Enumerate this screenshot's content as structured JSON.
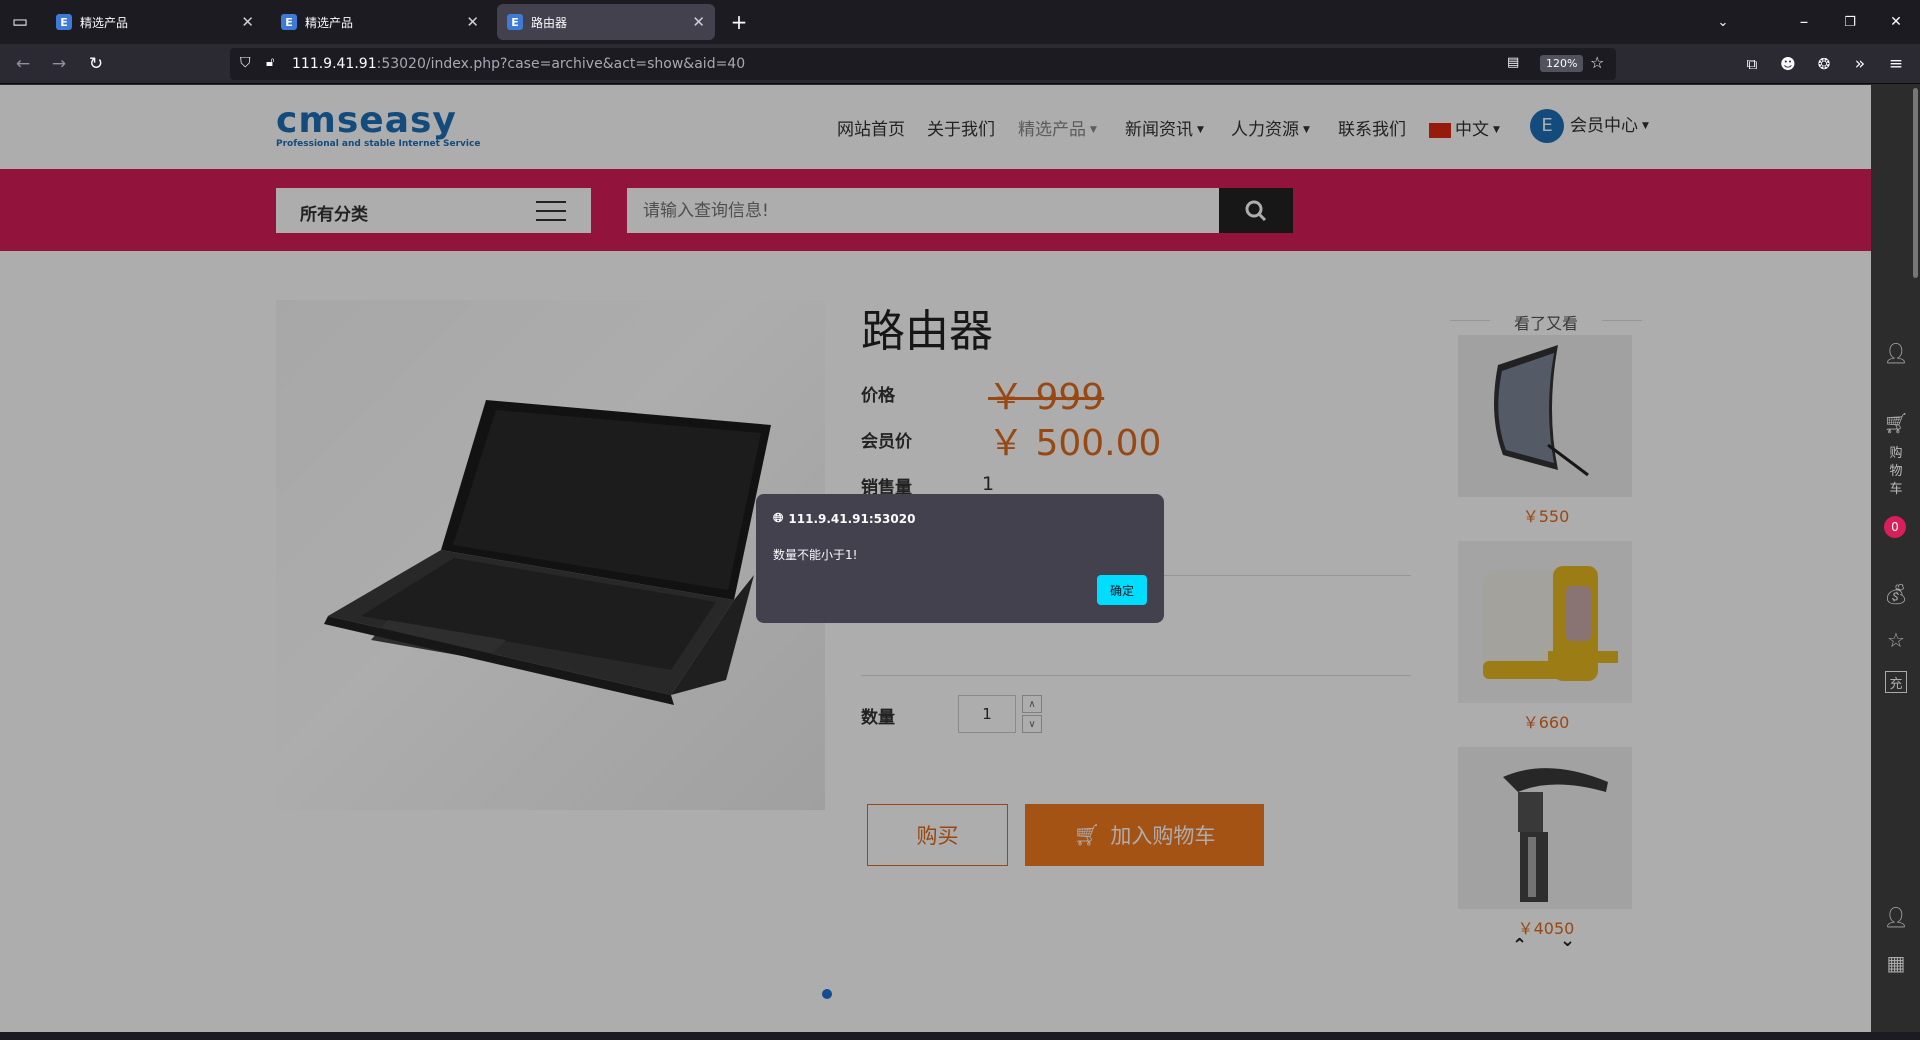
{
  "browser": {
    "tabs": [
      {
        "favicon": "E",
        "title": "精选产品",
        "active": false
      },
      {
        "favicon": "E",
        "title": "精选产品",
        "active": false
      },
      {
        "favicon": "E",
        "title": "路由器",
        "active": true
      }
    ],
    "url_host": "111.9.41.91",
    "url_rest": ":53020/index.php?case=archive&act=show&aid=40",
    "zoom": "120%"
  },
  "site": {
    "logo_text": "cmseasy",
    "logo_tagline": "Professional and stable Internet Service",
    "nav": [
      {
        "label": "网站首页",
        "caret": false
      },
      {
        "label": "关于我们",
        "caret": false
      },
      {
        "label": "精选产品",
        "caret": true
      },
      {
        "label": "新闻资讯",
        "caret": true
      },
      {
        "label": "人力资源",
        "caret": true
      },
      {
        "label": "联系我们",
        "caret": false
      }
    ],
    "language": "中文",
    "member_center": "会员中心",
    "category_label": "所有分类",
    "search_placeholder": "请输入查询信息!"
  },
  "product": {
    "title": "路由器",
    "price_label": "价格",
    "price_value": "￥ 999",
    "member_price_label": "会员价",
    "member_price_value": "￥ 500.00",
    "sold_label": "销售量",
    "sold_value": "1",
    "qty_label": "数量",
    "qty_value": "1",
    "buy_label": "购买",
    "cart_label": "加入购物车"
  },
  "related": {
    "title": "看了又看",
    "items": [
      {
        "price": "￥550"
      },
      {
        "price": "￥660"
      },
      {
        "price": "￥4050"
      }
    ]
  },
  "sidebar": {
    "cart_text": "购物车",
    "cart_count": "0",
    "recharge_icon_text": "充"
  },
  "dialog": {
    "origin": "111.9.41.91:53020",
    "message": "数量不能小于1!",
    "ok_label": "确定"
  },
  "colors": {
    "brand_red": "#d81e5b",
    "price_orange": "#e06b1d",
    "dialog_button": "#00ddff"
  }
}
